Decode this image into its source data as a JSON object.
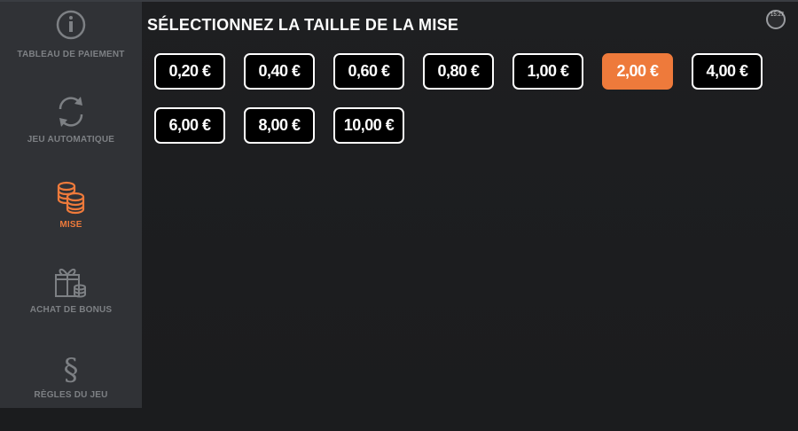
{
  "title": "SÉLECTIONNEZ LA TAILLE DE LA MISE",
  "clock": "15:27",
  "sidebar": {
    "items": [
      {
        "label": "TABLEAU DE PAIEMENT",
        "icon": "info-icon"
      },
      {
        "label": "JEU AUTOMATIQUE",
        "icon": "autoplay-icon"
      },
      {
        "label": "MISE",
        "icon": "coins-icon",
        "active": true
      },
      {
        "label": "ACHAT DE BONUS",
        "icon": "gift-icon"
      },
      {
        "label": "RÈGLES DU JEU",
        "icon": "section-icon"
      }
    ]
  },
  "bets": [
    "0,20 €",
    "0,40 €",
    "0,60 €",
    "0,80 €",
    "1,00 €",
    "2,00 €",
    "4,00 €",
    "6,00 €",
    "8,00 €",
    "10,00 €"
  ],
  "selected_bet": "2,00 €",
  "colors": {
    "accent": "#ee7a3b",
    "sidebar": "#303236",
    "inactive": "#7d8084",
    "button_bg": "#000000"
  }
}
